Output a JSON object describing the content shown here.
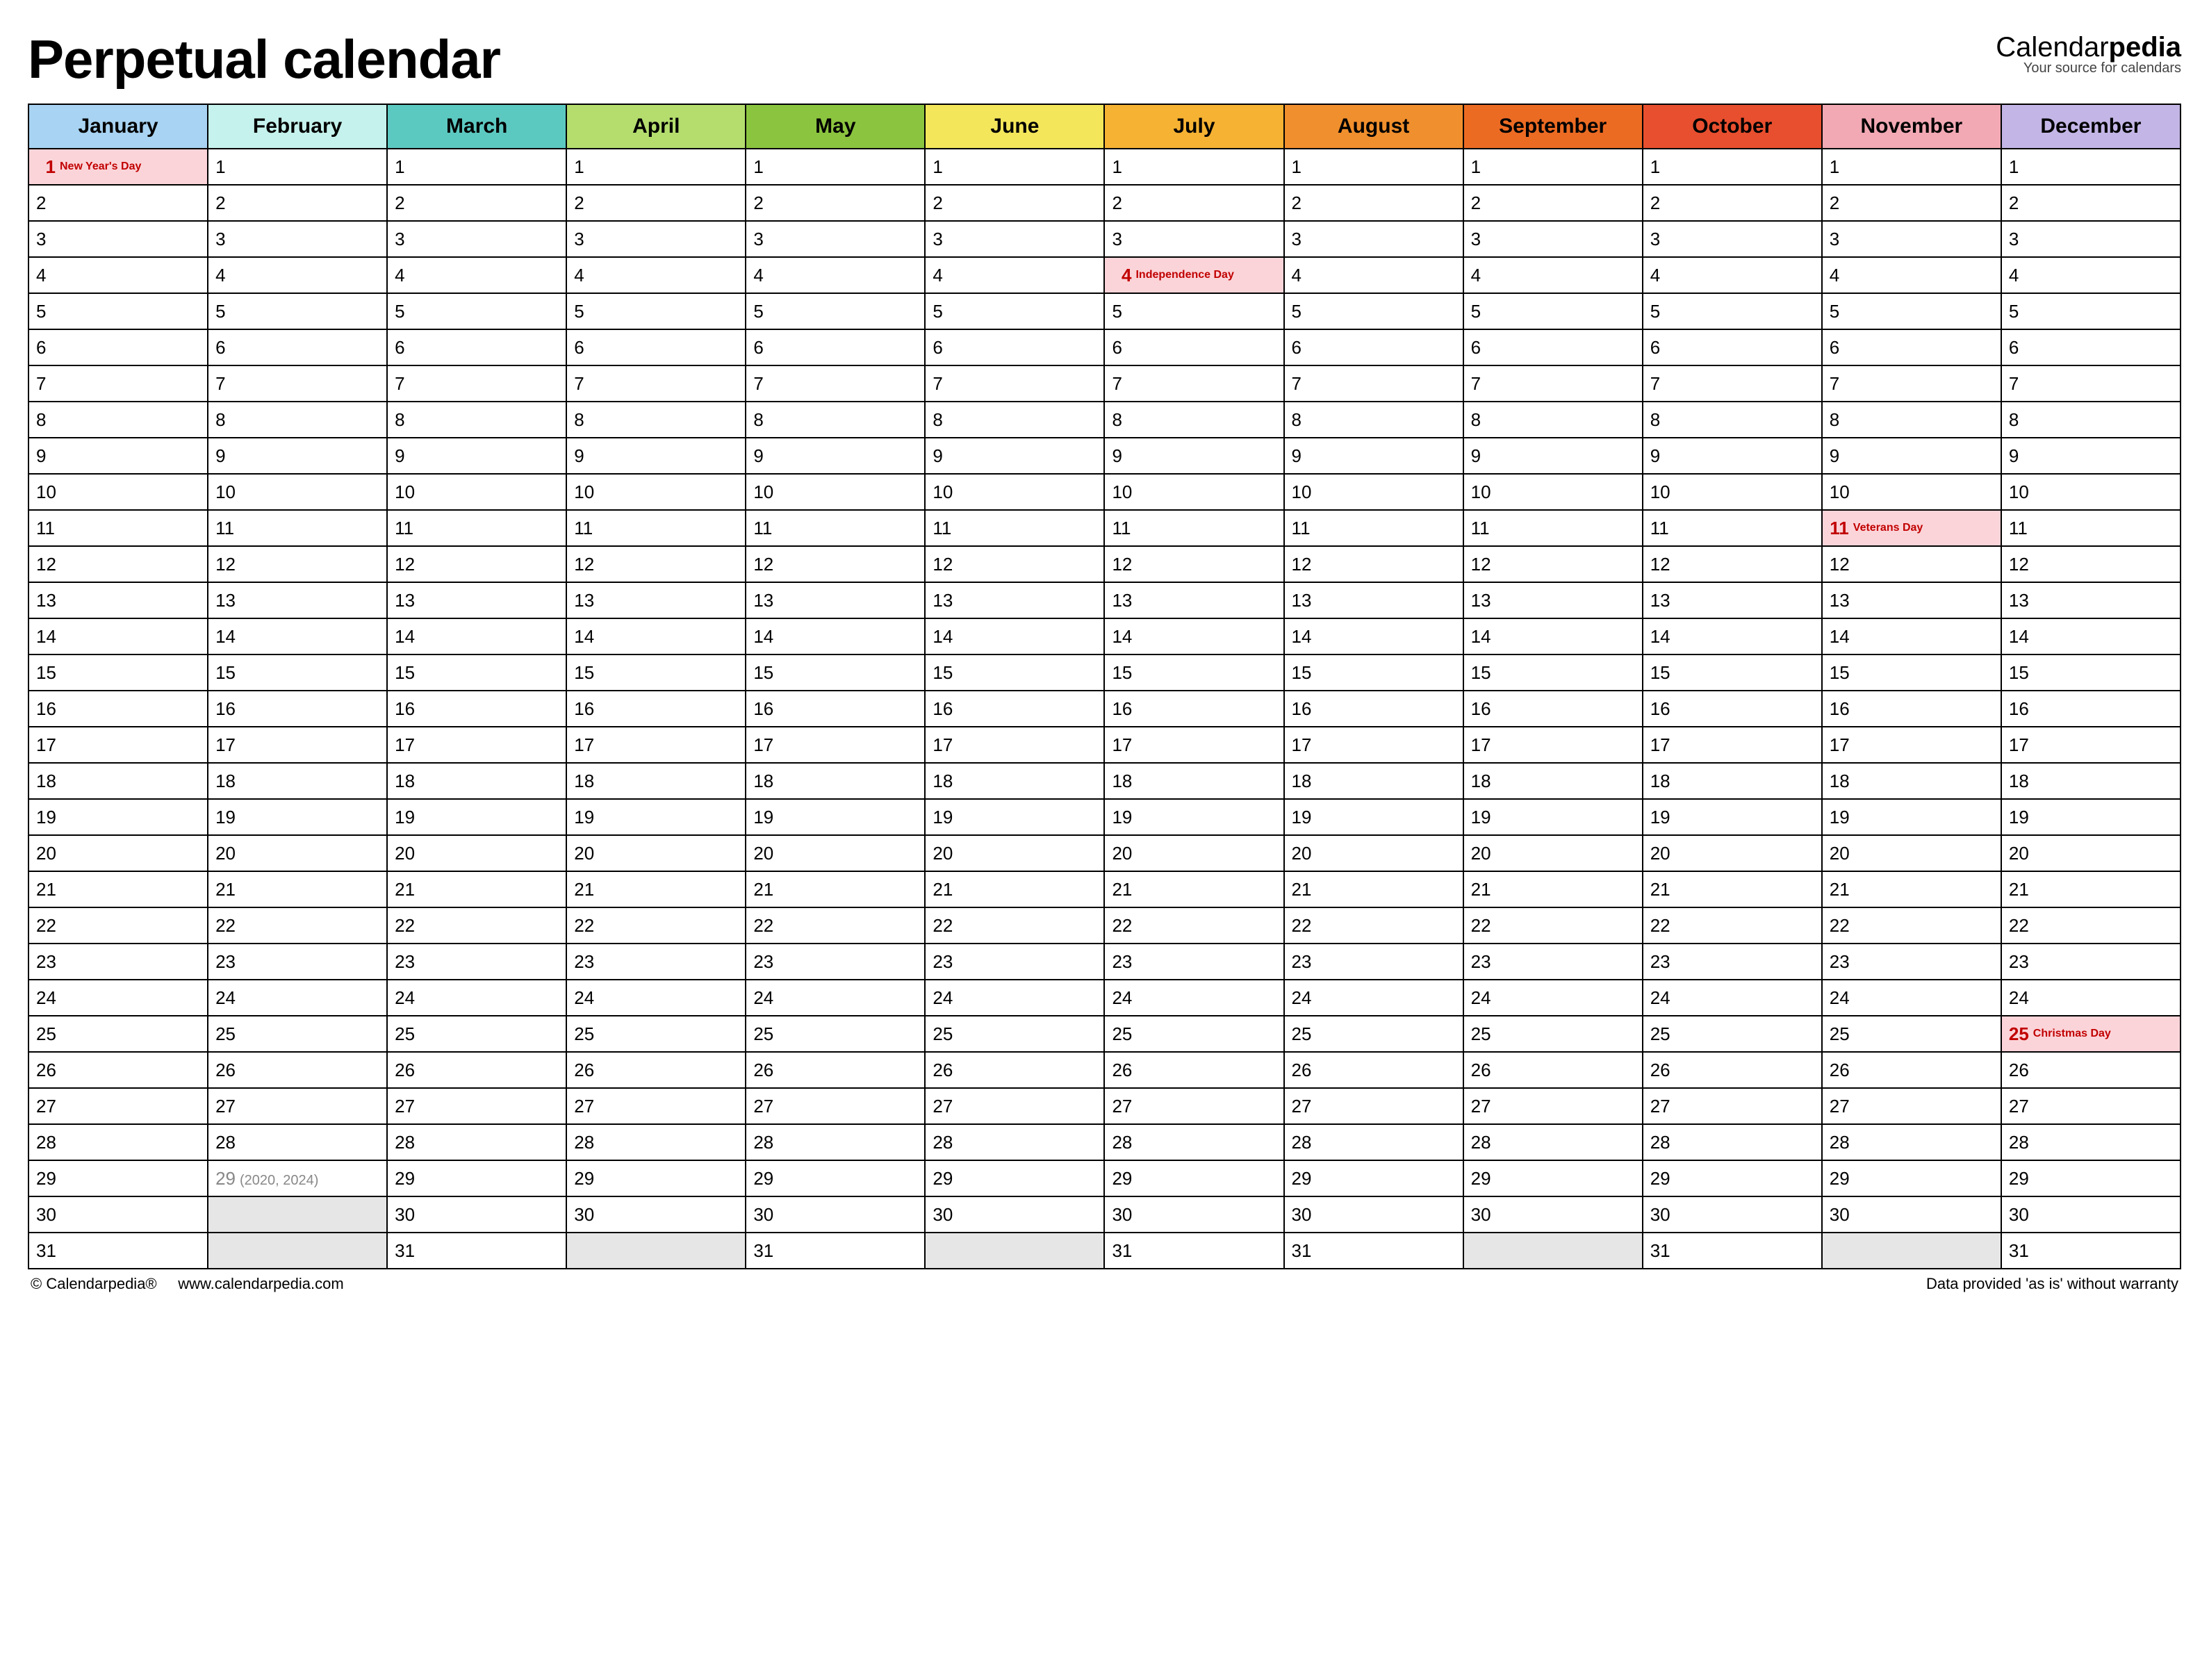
{
  "title": "Perpetual calendar",
  "brand": {
    "part1": "Calendar",
    "part2": "pedia",
    "tagline": "Your source for calendars"
  },
  "months": [
    {
      "name": "January",
      "color": "#A8D3F2",
      "days": 31
    },
    {
      "name": "February",
      "color": "#C5F2EC",
      "days": 29
    },
    {
      "name": "March",
      "color": "#5CC9C1",
      "days": 31
    },
    {
      "name": "April",
      "color": "#B4DD6E",
      "days": 30
    },
    {
      "name": "May",
      "color": "#8BC43F",
      "days": 31
    },
    {
      "name": "June",
      "color": "#F3E65A",
      "days": 30
    },
    {
      "name": "July",
      "color": "#F6B233",
      "days": 31
    },
    {
      "name": "August",
      "color": "#F08F2D",
      "days": 31
    },
    {
      "name": "September",
      "color": "#EC6B23",
      "days": 30
    },
    {
      "name": "October",
      "color": "#E84F2E",
      "days": 31
    },
    {
      "name": "November",
      "color": "#F2A9B4",
      "days": 30
    },
    {
      "name": "December",
      "color": "#C3B6E6",
      "days": 31
    }
  ],
  "max_days": 31,
  "holidays": [
    {
      "month": 0,
      "day": 1,
      "label": "New Year's Day"
    },
    {
      "month": 6,
      "day": 4,
      "label": "Independence Day"
    },
    {
      "month": 10,
      "day": 11,
      "label": "Veterans Day"
    },
    {
      "month": 11,
      "day": 25,
      "label": "Christmas Day"
    }
  ],
  "leap_note": {
    "month": 1,
    "day": 29,
    "text": "(2020, 2024)"
  },
  "footer": {
    "left_copyright": "© Calendarpedia®",
    "left_url": "www.calendarpedia.com",
    "right": "Data provided 'as is' without warranty"
  }
}
